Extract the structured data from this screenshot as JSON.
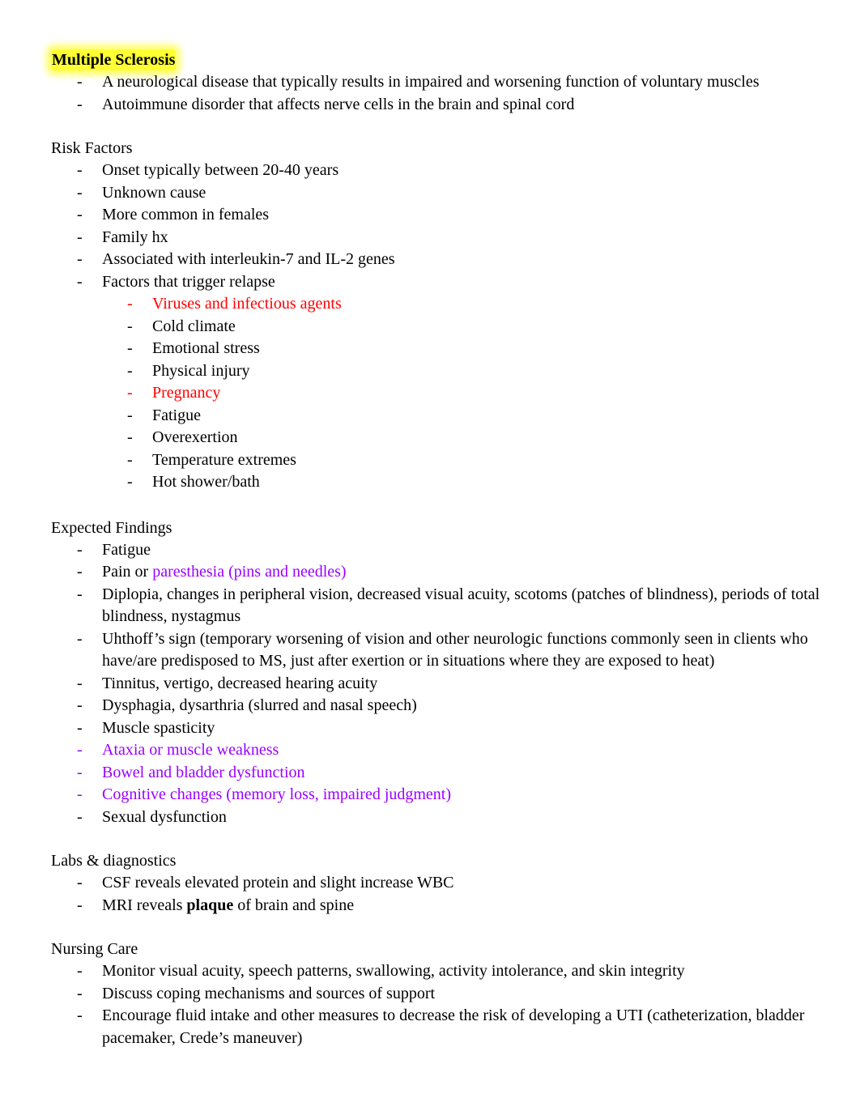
{
  "document": {
    "title": "Multiple Sclerosis",
    "intro": [
      "A neurological disease that typically results in impaired and worsening function of voluntary muscles",
      "Autoimmune disorder that affects nerve cells in the brain and spinal cord"
    ],
    "colors": {
      "highlight": "#ffff33",
      "red": "#ff0000",
      "purple": "#9900ff",
      "text": "#000000"
    },
    "risk_factors": {
      "heading": "Risk Factors",
      "items": [
        "Onset typically between 20-40 years",
        "Unknown cause",
        "More common in females",
        "Family hx",
        "Associated with interleukin-7 and IL-2 genes"
      ],
      "relapse": {
        "label": "Factors that trigger relapse",
        "items": [
          {
            "text": "Viruses and infectious agents",
            "color": "red"
          },
          {
            "text": "Cold climate",
            "color": "black"
          },
          {
            "text": "Emotional stress",
            "color": "black"
          },
          {
            "text": "Physical injury",
            "color": "black"
          },
          {
            "text": "Pregnancy",
            "color": "red"
          },
          {
            "text": "Fatigue",
            "color": "black"
          },
          {
            "text": "Overexertion",
            "color": "black"
          },
          {
            "text": "Temperature extremes",
            "color": "black"
          },
          {
            "text": "Hot shower/bath",
            "color": "black"
          }
        ]
      }
    },
    "expected_findings": {
      "heading": "Expected Findings",
      "items": [
        {
          "text": "Fatigue"
        },
        {
          "prefix": "Pain or ",
          "highlight": "paresthesia (pins and needles)"
        },
        {
          "text": "Diplopia, changes in peripheral vision, decreased visual acuity, scotoms (patches of blindness), periods of total blindness, nystagmus"
        },
        {
          "text": "Uhthoff’s sign (temporary worsening of vision and other neurologic functions commonly seen in clients who have/are predisposed to MS, just after exertion or in situations where they are exposed to heat)"
        },
        {
          "text": "Tinnitus, vertigo, decreased hearing acuity"
        },
        {
          "text": "Dysphagia, dysarthria (slurred and nasal speech)"
        },
        {
          "text": "Muscle spasticity"
        },
        {
          "text": "Ataxia or muscle weakness",
          "color": "purple"
        },
        {
          "text": "Bowel and bladder dysfunction",
          "color": "purple"
        },
        {
          "text": "Cognitive changes (memory loss, impaired judgment)",
          "color": "purple"
        },
        {
          "text": "Sexual dysfunction"
        }
      ]
    },
    "labs": {
      "heading": "Labs & diagnostics",
      "items": [
        {
          "text": "CSF reveals elevated protein and slight increase WBC"
        },
        {
          "prefix": "MRI reveals ",
          "bold": "plaque",
          "suffix": " of brain and spine"
        }
      ]
    },
    "nursing_care": {
      "heading": "Nursing Care",
      "items": [
        "Monitor visual acuity, speech patterns, swallowing, activity intolerance, and skin integrity",
        "Discuss coping mechanisms and sources of support",
        "Encourage fluid intake and other measures to decrease the risk of developing a UTI (catheterization, bladder pacemaker, Crede’s maneuver)"
      ]
    }
  }
}
